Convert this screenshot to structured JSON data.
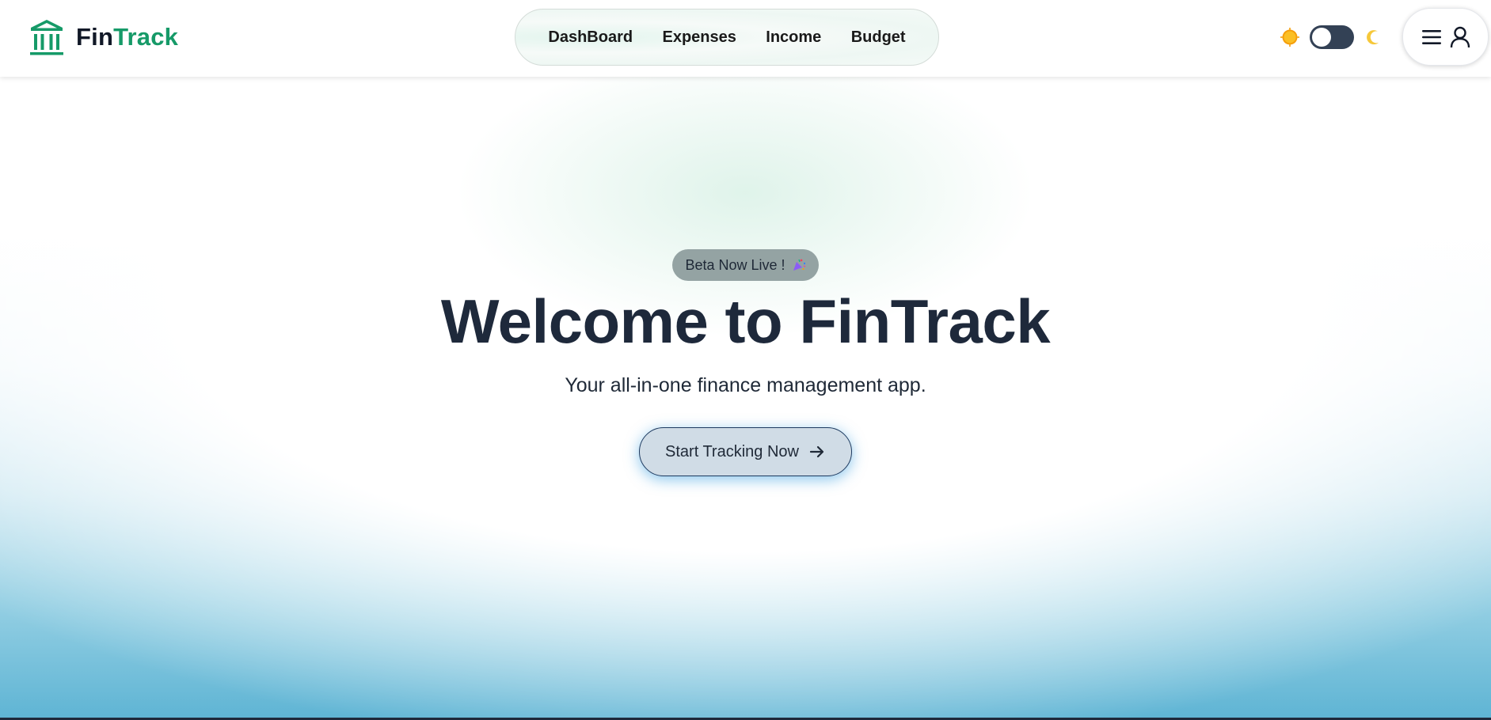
{
  "brand": {
    "name_part1": "Fin",
    "name_part2": "Track",
    "icon": "bank-icon",
    "accent_color": "#169a68"
  },
  "nav": {
    "items": [
      {
        "label": "DashBoard"
      },
      {
        "label": "Expenses"
      },
      {
        "label": "Income"
      },
      {
        "label": "Budget"
      }
    ]
  },
  "theme_toggle": {
    "left_icon": "sun-icon",
    "right_icon": "moon-icon",
    "state": "light"
  },
  "user_menu": {
    "icons": [
      "hamburger-icon",
      "user-icon"
    ]
  },
  "hero": {
    "badge": "Beta Now Live !",
    "badge_icon": "party-popper-icon",
    "title": "Welcome to FinTrack",
    "subtitle": "Your all-in-one finance management app.",
    "cta_label": "Start Tracking Now",
    "cta_icon": "arrow-right-icon"
  },
  "colors": {
    "title": "#1e293b",
    "badge_bg": "#94a3a3",
    "cta_bg": "#d0dce6",
    "cta_glow": "#2896dc",
    "toggle_track": "#334155"
  }
}
